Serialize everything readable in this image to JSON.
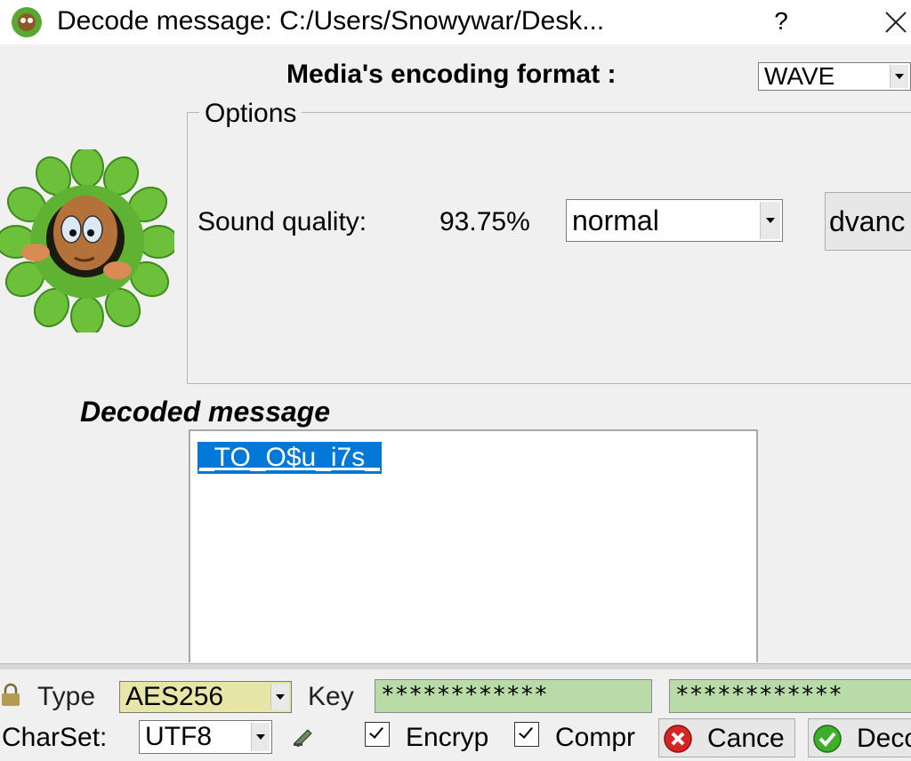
{
  "window": {
    "title": "Decode message: C:/Users/Snowywar/Desk...",
    "help_label": "?",
    "close_icon": "close-icon",
    "app_icon": "mascot-app-icon"
  },
  "encoding": {
    "label": "Media's encoding format :",
    "format_value": "WAVE"
  },
  "options": {
    "legend": "Options",
    "sound_quality_label": "Sound quality:",
    "sound_quality_value": "93.75%",
    "quality_select_value": "normal",
    "advanced_button_label": "dvanc"
  },
  "decoded": {
    "label": "Decoded message",
    "text": "_TO_O$u_i7s_"
  },
  "bottom": {
    "type_label": "Type",
    "type_value": "AES256",
    "key_label": "Key",
    "key_value_1": "************",
    "key_value_2": "************",
    "charset_label": "CharSet:",
    "charset_value": "UTF8",
    "encrypt_label": "Encryp",
    "encrypt_checked": true,
    "compress_label": "Compr",
    "compress_checked": true,
    "cancel_label": "Cance",
    "decode_label": "Deco"
  },
  "colors": {
    "selection": "#0078d7",
    "key_field": "#b8dba7",
    "type_field": "#e8e6a6",
    "window_bg": "#f0f0f0"
  }
}
